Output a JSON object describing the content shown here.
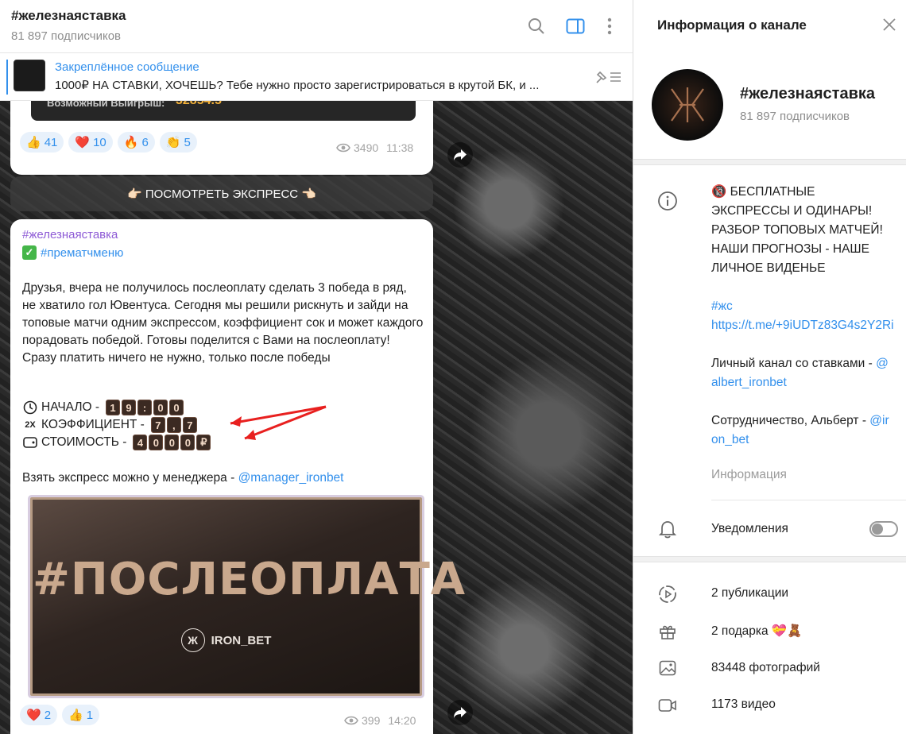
{
  "chat": {
    "title": "#железнаяставка",
    "subscribers": "81 897 подписчиков",
    "pinned": {
      "label": "Закреплённое сообщение",
      "text": "1000₽ НА СТАВКИ, ХОЧЕШЬ? Тебе нужно просто зарегистрироваться в крутой БК, и ..."
    }
  },
  "message1": {
    "bet_label": "Возможный Выигрыш:",
    "bet_value": "32854.5",
    "reactions": [
      {
        "emoji": "👍",
        "count": "41"
      },
      {
        "emoji": "❤️",
        "count": "10"
      },
      {
        "emoji": "🔥",
        "count": "6"
      },
      {
        "emoji": "👏",
        "count": "5"
      }
    ],
    "views": "3490",
    "time": "11:38"
  },
  "express_button": "👉🏻 ПОСМОТРЕТЬ ЭКСПРЕСС 👈🏻",
  "message2": {
    "channel": "#железнаяставка",
    "tag": "#прематчменю",
    "body": "Друзья, вчера не получилось послеоплату сделать 3 победа в ряд, не хватило гол Ювентуса. Сегодня мы решили рискнуть и зайди на топовые матчи одним экспрессом, коэффициент сок и может каждого порадовать победой. Готовы поделится с Вами на послеоплату! Сразу платить ничего не нужно, только после победы",
    "start_label": "НАЧАЛО -",
    "start_digits": [
      "1",
      "9",
      ":",
      "0",
      "0"
    ],
    "coef_label": "КОЭФФИЦИЕНТ -",
    "coef_digits": [
      "7",
      ",",
      "7"
    ],
    "cost_label": "СТОИМОСТЬ -",
    "cost_digits": [
      "4",
      "0",
      "0",
      "0",
      "₽"
    ],
    "manager_text": "Взять экспресс можно у менеджера - ",
    "manager_link": "@manager_ironbet",
    "promo_title": "#ПОСЛЕОПЛАТА",
    "promo_brand": "IRON_BET",
    "reactions": [
      {
        "emoji": "❤️",
        "count": "2"
      },
      {
        "emoji": "👍",
        "count": "1"
      }
    ],
    "views": "399",
    "time": "14:20"
  },
  "info_panel": {
    "title": "Информация о канале",
    "channel_name": "#железнаяставка",
    "subscribers": "81 897 подписчиков",
    "about_main": "🔞 БЕСПЛАТНЫЕ ЭКСПРЕССЫ И ОДИНАРЫ! РАЗБОР ТОПОВЫХ МАТЧЕЙ! НАШИ ПРОГНОЗЫ - НАШЕ ЛИЧНОЕ ВИДЕНЬЕ",
    "about_tag": "#жс",
    "about_link": "https://t.me/+9iUDTz83G4s2Y2Ri",
    "personal_text": "Личный канал со ставками - ",
    "personal_link": "@albert_ironbet",
    "coop_text": "Сотрудничество, Альберт - ",
    "coop_link": "@iron_bet",
    "about_label": "Информация",
    "notifications": "Уведомления",
    "notifications_on": false,
    "publications": "2 публикации",
    "gifts": "2 подарка 💝🧸",
    "photos": "83448 фотографий",
    "videos": "1173 видео"
  },
  "colors": {
    "accent": "#3390ec",
    "channel_name": "#8e5bd6",
    "bet_value": "#f1b03a"
  }
}
